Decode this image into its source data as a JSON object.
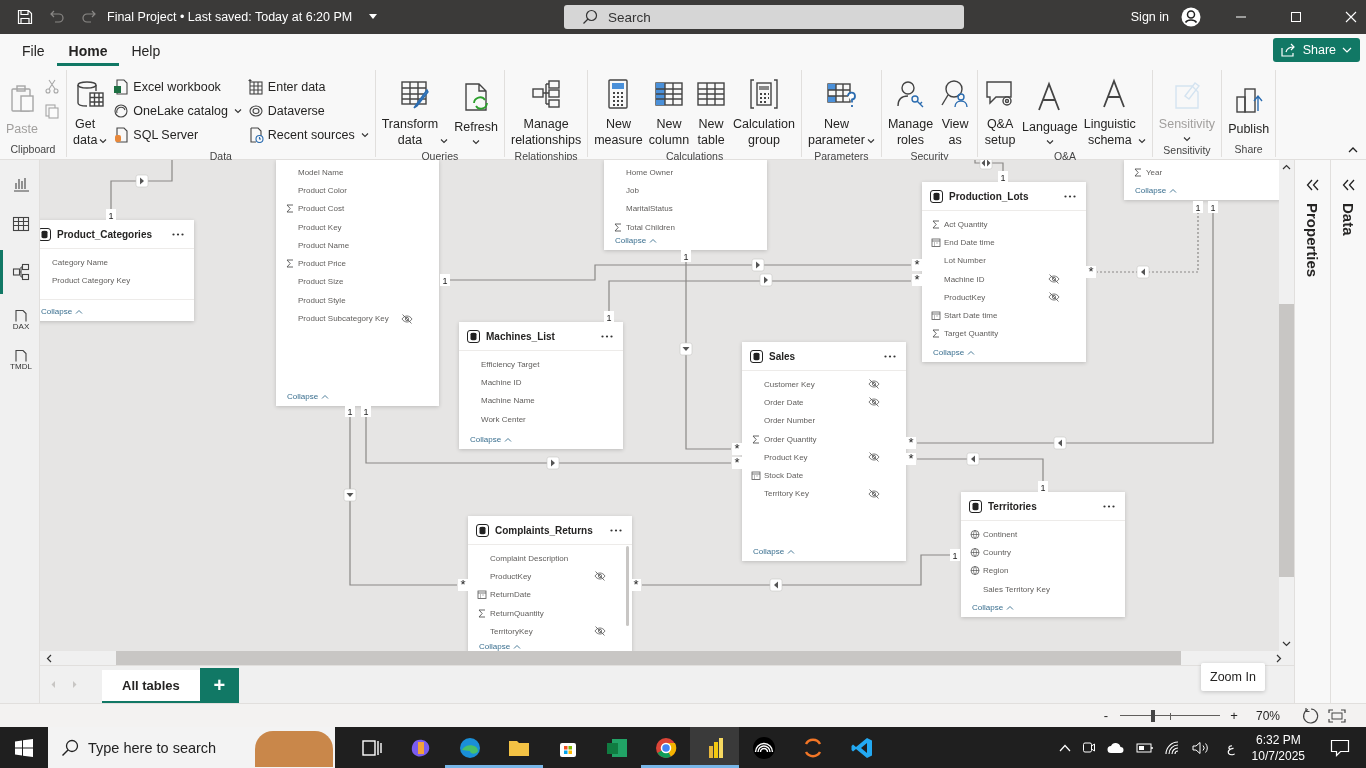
{
  "title_bar": {
    "title": "Final Project • Last saved: Today at 6:20 PM",
    "search": {
      "placeholder": "Search"
    },
    "sign_in": "Sign in"
  },
  "menu_tabs": [
    {
      "label": "File",
      "selected": false
    },
    {
      "label": "Home",
      "selected": true
    },
    {
      "label": "Help",
      "selected": false
    }
  ],
  "share_button": "Share",
  "ribbon": [
    {
      "label": "Clipboard",
      "columns": [
        {
          "kind": "large",
          "items": [
            {
              "label": "Paste",
              "disabled": true,
              "dropdown": false
            }
          ]
        },
        {
          "kind": "small",
          "items": [
            {
              "disabled": true,
              "dropdown": false
            },
            {
              "disabled": true,
              "dropdown": false
            }
          ]
        }
      ]
    },
    {
      "label": "Data",
      "columns": [
        {
          "kind": "large",
          "items": [
            {
              "label": "Get data",
              "disabled": false,
              "dropdown": true
            }
          ]
        },
        {
          "kind": "small",
          "items": [
            {
              "label": "Excel workbook",
              "disabled": false,
              "dropdown": false
            },
            {
              "label": "OneLake catalog",
              "disabled": false,
              "dropdown": true
            },
            {
              "label": "SQL Server",
              "disabled": false,
              "dropdown": false
            }
          ]
        },
        {
          "kind": "small",
          "items": [
            {
              "label": "Enter data",
              "disabled": false,
              "dropdown": false
            },
            {
              "label": "Dataverse",
              "disabled": false,
              "dropdown": false
            },
            {
              "label": "Recent sources",
              "disabled": false,
              "dropdown": true
            }
          ]
        }
      ]
    },
    {
      "label": "Queries",
      "columns": [
        {
          "kind": "large",
          "items": [
            {
              "label": "Transform data",
              "disabled": false,
              "dropdown": true
            },
            {
              "label": "Refresh",
              "disabled": false,
              "dropdown": true
            }
          ]
        }
      ]
    },
    {
      "label": "Relationships",
      "columns": [
        {
          "kind": "large",
          "items": [
            {
              "label": "Manage relationships",
              "disabled": false,
              "dropdown": false
            }
          ]
        }
      ]
    },
    {
      "label": "Calculations",
      "columns": [
        {
          "kind": "large",
          "items": [
            {
              "label": "New measure",
              "disabled": false,
              "dropdown": false
            },
            {
              "label": "New column",
              "disabled": false,
              "dropdown": false
            },
            {
              "label": "New table",
              "disabled": false,
              "dropdown": false
            },
            {
              "label": "Calculation group",
              "disabled": false,
              "dropdown": false
            }
          ]
        }
      ]
    },
    {
      "label": "Parameters",
      "columns": [
        {
          "kind": "large",
          "items": [
            {
              "label": "New parameter",
              "disabled": false,
              "dropdown": true
            }
          ]
        }
      ]
    },
    {
      "label": "Security",
      "columns": [
        {
          "kind": "large",
          "items": [
            {
              "label": "Manage roles",
              "disabled": false,
              "dropdown": false
            },
            {
              "label": "View as",
              "disabled": false,
              "dropdown": false
            }
          ]
        }
      ]
    },
    {
      "label": "Q&A",
      "columns": [
        {
          "kind": "large",
          "items": [
            {
              "label": "Q&A setup",
              "disabled": false,
              "dropdown": false
            },
            {
              "label": "Language",
              "disabled": false,
              "dropdown": true
            },
            {
              "label": "Linguistic schema",
              "disabled": false,
              "dropdown": true
            }
          ]
        }
      ]
    },
    {
      "label": "Sensitivity",
      "columns": [
        {
          "kind": "large",
          "items": [
            {
              "label": "Sensitivity",
              "disabled": true,
              "dropdown": true
            }
          ]
        }
      ]
    },
    {
      "label": "Share",
      "columns": [
        {
          "kind": "large",
          "items": [
            {
              "label": "Publish",
              "disabled": false,
              "dropdown": false
            }
          ]
        }
      ]
    }
  ],
  "view_rail": [
    {
      "selected": false
    },
    {
      "selected": false
    },
    {
      "selected": true
    },
    {
      "label": "DAX",
      "selected": false
    },
    {
      "label": "TMDL",
      "selected": false
    }
  ],
  "cards": [
    {
      "title": "Product_Categories",
      "fields": [
        {
          "name": "Category Name",
          "kind": "text",
          "hidden": false
        },
        {
          "name": "Product Category Key",
          "kind": "text",
          "hidden": false
        }
      ],
      "collapse": "Collapse"
    },
    {
      "fields": [
        {
          "name": "Model Name",
          "kind": "text",
          "hidden": false
        },
        {
          "name": "Product Color",
          "kind": "text",
          "hidden": false
        },
        {
          "name": "Product Cost",
          "kind": "sum",
          "hidden": false
        },
        {
          "name": "Product Key",
          "kind": "text",
          "hidden": false
        },
        {
          "name": "Product Name",
          "kind": "text",
          "hidden": false
        },
        {
          "name": "Product Price",
          "kind": "sum",
          "hidden": false
        },
        {
          "name": "Product Size",
          "kind": "text",
          "hidden": false
        },
        {
          "name": "Product Style",
          "kind": "text",
          "hidden": false
        },
        {
          "name": "Product Subcategory Key",
          "kind": "text",
          "hidden": true
        }
      ],
      "collapse": "Collapse"
    },
    {
      "fields": [
        {
          "name": "Home Owner",
          "kind": "text",
          "hidden": false
        },
        {
          "name": "Job",
          "kind": "text",
          "hidden": false
        },
        {
          "name": "MaritalStatus",
          "kind": "text",
          "hidden": false
        },
        {
          "name": "Total Children",
          "kind": "sum",
          "hidden": false
        }
      ],
      "collapse": "Collapse"
    },
    {
      "title": "Machines_List",
      "fields": [
        {
          "name": "Efficiency Target",
          "kind": "text",
          "hidden": false
        },
        {
          "name": "Machine ID",
          "kind": "text",
          "hidden": false
        },
        {
          "name": "Machine Name",
          "kind": "text",
          "hidden": false
        },
        {
          "name": "Work Center",
          "kind": "text",
          "hidden": false
        }
      ],
      "collapse": "Collapse"
    },
    {
      "title": "Production_Lots",
      "fields": [
        {
          "name": "Act Quantity",
          "kind": "sum",
          "hidden": false
        },
        {
          "name": "End Date time",
          "kind": "date",
          "hidden": false
        },
        {
          "name": "Lot Number",
          "kind": "text",
          "hidden": false
        },
        {
          "name": "Machine ID",
          "kind": "text",
          "hidden": true
        },
        {
          "name": "ProductKey",
          "kind": "text",
          "hidden": true
        },
        {
          "name": "Start Date time",
          "kind": "date",
          "hidden": false
        },
        {
          "name": "Target Quantity",
          "kind": "sum",
          "hidden": false
        }
      ],
      "collapse": "Collapse"
    },
    {
      "fields": [
        {
          "name": "Year",
          "kind": "sum",
          "hidden": false
        }
      ],
      "collapse": "Collapse"
    },
    {
      "title": "Sales",
      "fields": [
        {
          "name": "Customer Key",
          "kind": "text",
          "hidden": true
        },
        {
          "name": "Order Date",
          "kind": "text",
          "hidden": true
        },
        {
          "name": "Order Number",
          "kind": "text",
          "hidden": false
        },
        {
          "name": "Order Quantity",
          "kind": "sum",
          "hidden": false
        },
        {
          "name": "Product Key",
          "kind": "text",
          "hidden": true
        },
        {
          "name": "Stock Date",
          "kind": "date",
          "hidden": false
        },
        {
          "name": "Territory Key",
          "kind": "text",
          "hidden": true
        }
      ],
      "collapse": "Collapse"
    },
    {
      "title": "Territories",
      "fields": [
        {
          "name": "Continent",
          "kind": "geo",
          "hidden": false
        },
        {
          "name": "Country",
          "kind": "geo",
          "hidden": false
        },
        {
          "name": "Region",
          "kind": "geo",
          "hidden": false
        },
        {
          "name": "Sales Territory Key",
          "kind": "text",
          "hidden": false
        }
      ],
      "collapse": "Collapse"
    },
    {
      "title": "Complaints_Returns",
      "fields": [
        {
          "name": "Complaint Description",
          "kind": "text",
          "hidden": false
        },
        {
          "name": "ProductKey",
          "kind": "text",
          "hidden": true
        },
        {
          "name": "ReturnDate",
          "kind": "date",
          "hidden": false
        },
        {
          "name": "ReturnQuantity",
          "kind": "sum",
          "hidden": false
        },
        {
          "name": "TerritoryKey",
          "kind": "text",
          "hidden": true
        }
      ],
      "collapse": "Collapse"
    }
  ],
  "relationships": [
    {
      "one": "1",
      "kind": "single",
      "active": true
    },
    {
      "one": "1",
      "many": "*",
      "kind": "single",
      "active": true
    },
    {
      "one": "1",
      "many": "*",
      "kind": "single",
      "active": true
    },
    {
      "one": "1",
      "many": "*",
      "kind": "single",
      "active": true
    },
    {
      "one": "1",
      "many": "*",
      "kind": "single",
      "active": true
    },
    {
      "one": "1",
      "many": "*",
      "kind": "single",
      "active": true
    },
    {
      "one": "1",
      "many": "*",
      "kind": "single",
      "active": false
    },
    {
      "one": "1",
      "many": "*",
      "kind": "single",
      "active": true
    },
    {
      "one": "1",
      "many": "*",
      "kind": "single",
      "active": true
    },
    {
      "one": "1",
      "many": "*",
      "kind": "single",
      "active": true
    },
    {
      "one": "1",
      "kind": "both",
      "active": true
    }
  ],
  "side_panes": [
    {
      "label": "Properties"
    },
    {
      "label": "Data"
    }
  ],
  "page_tabs": [
    {
      "label": "All tables",
      "selected": true
    }
  ],
  "add_page_button": "+",
  "status_bar": {
    "zoom_out": "-",
    "zoom_in": "+",
    "level": 0.33,
    "zoom_level": "70%",
    "tooltip": "Zoom In"
  },
  "taskbar": {
    "search": {
      "placeholder": "Type here to search"
    },
    "apps": [
      {
        "running": false,
        "selected": false
      },
      {
        "running": false,
        "selected": false
      },
      {
        "running": true,
        "selected": false
      },
      {
        "running": true,
        "selected": false
      },
      {
        "running": false,
        "selected": false
      },
      {
        "running": false,
        "selected": false
      },
      {
        "running": true,
        "selected": false
      },
      {
        "running": true,
        "selected": true
      },
      {
        "running": false,
        "selected": false
      },
      {
        "running": false,
        "selected": false
      },
      {
        "running": false,
        "selected": false
      }
    ],
    "input_language": "ع",
    "time": "6:32 PM",
    "date": "10/7/2025"
  }
}
